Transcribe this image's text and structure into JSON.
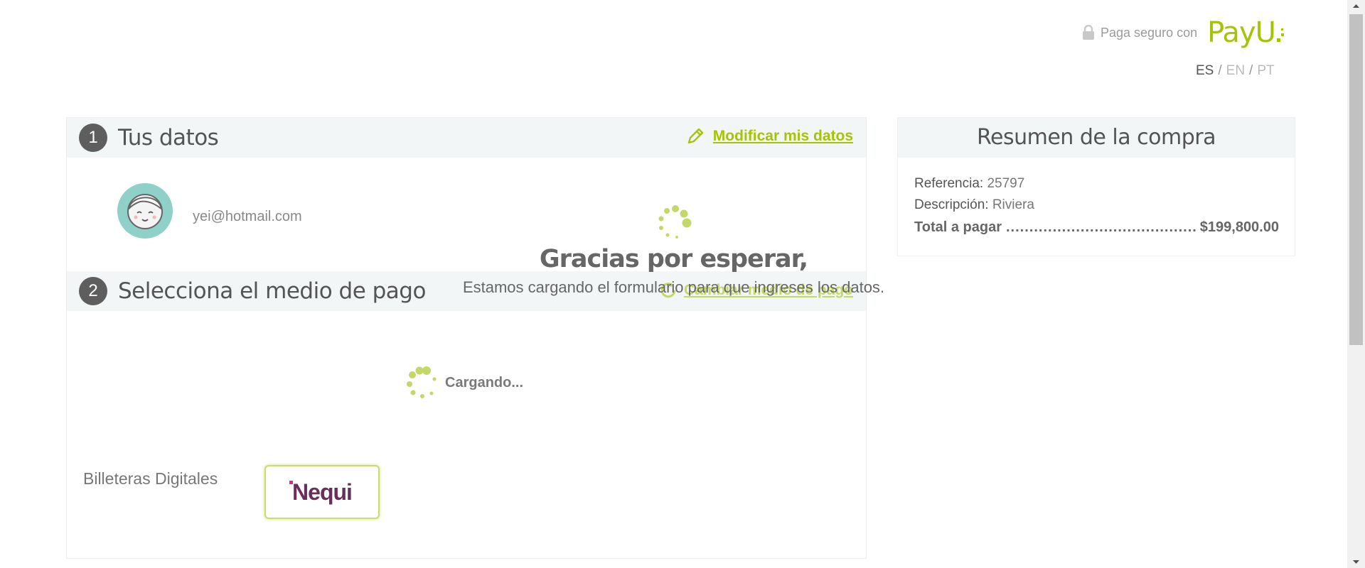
{
  "header": {
    "secure_text": "Paga seguro con",
    "brand": "PayU",
    "languages": [
      "ES",
      "EN",
      "PT"
    ],
    "active_language": "ES"
  },
  "section1": {
    "number": "1",
    "title": "Tus datos",
    "edit_label": "Modificar mis datos",
    "email": "yei@hotmail.com"
  },
  "section2": {
    "number": "2",
    "title": "Selecciona el medio de pago",
    "change_label": "Cambiar medio de pago",
    "loading": "Cargando...",
    "wallet_label": "Billeteras Digitales",
    "wallet_option": "Nequi"
  },
  "overlay": {
    "title": "Gracias por esperar,",
    "subtitle": "Estamos cargando el formulario para que ingreses los datos."
  },
  "summary": {
    "title": "Resumen de la compra",
    "reference_label": "Referencia:",
    "reference_value": "25797",
    "description_label": "Descripción:",
    "description_value": "Riviera",
    "total_label": "Total a pagar",
    "total_value": "$199,800.00"
  },
  "colors": {
    "brand": "#a6c307",
    "avatar": "#8fd0c8",
    "nequi": "#6b2e5b",
    "nequi_accent": "#e0288c"
  }
}
